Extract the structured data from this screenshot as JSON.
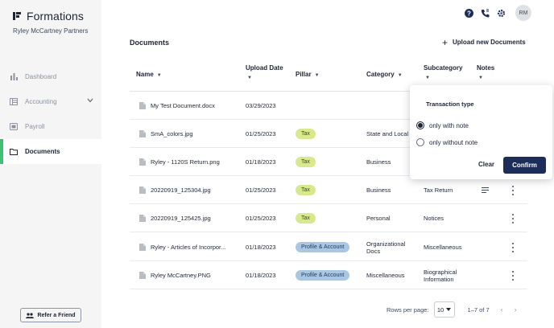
{
  "sidebar": {
    "brand": "Formations",
    "company": "Ryley McCartney Partners",
    "items": [
      {
        "label": "Dashboard",
        "icon": "bar-chart-icon"
      },
      {
        "label": "Accounting",
        "icon": "ledger-icon"
      },
      {
        "label": "Payroll",
        "icon": "payroll-icon"
      },
      {
        "label": "Documents",
        "icon": "folder-icon"
      }
    ],
    "active_item": "Documents",
    "refer_label": "Refer a Friend"
  },
  "topbar": {
    "icons": [
      "help-icon",
      "phone-icon",
      "gear-icon"
    ],
    "avatar_initials": "RM"
  },
  "main": {
    "title": "Documents",
    "upload_label": "Upload new Documents",
    "columns": {
      "name": "Name",
      "upload_date_line1": "Upload Date",
      "pillar": "Pillar",
      "category": "Category",
      "subcategory": "Subcategory",
      "notes": "Notes"
    },
    "rows": [
      {
        "name": "My Test Document.docx",
        "date": "03/29/2023",
        "pillar": "",
        "category": "",
        "subcategory": "",
        "has_notes": false
      },
      {
        "name": "SmA_colors.jpg",
        "date": "01/25/2023",
        "pillar": "Tax",
        "category": "State and Local",
        "subcategory": "",
        "has_notes": false
      },
      {
        "name": "Ryley - 1120S Return.png",
        "date": "01/18/2023",
        "pillar": "Tax",
        "category": "Business",
        "subcategory": "",
        "has_notes": false
      },
      {
        "name": "20220919_125304.jpg",
        "date": "01/25/2023",
        "pillar": "Tax",
        "category": "Business",
        "subcategory": "Tax Return",
        "has_notes": true
      },
      {
        "name": "20220919_125425.jpg",
        "date": "01/25/2023",
        "pillar": "Tax",
        "category": "Personal",
        "subcategory": "Notices",
        "has_notes": false
      },
      {
        "name": "Ryley - Articles of Incorpor...",
        "date": "01/18/2023",
        "pillar": "Profile & Account",
        "category": "Organizational Docs",
        "subcategory": "Miscellaneous",
        "has_notes": false
      },
      {
        "name": "Ryley McCartney.PNG",
        "date": "01/18/2023",
        "pillar": "Profile & Account",
        "category": "Miscellaneous",
        "subcategory": "Biographical Information",
        "has_notes": false
      }
    ]
  },
  "pagination": {
    "rows_per_page_label": "Rows per page:",
    "rows_per_page_value": "10",
    "range": "1–7 of 7"
  },
  "filter_popover": {
    "title": "Transaction type",
    "options": [
      "only with note",
      "only without note"
    ],
    "selected": "only with note",
    "clear_label": "Clear",
    "confirm_label": "Confirm"
  },
  "colors": {
    "accent_active": "#3fbf73",
    "tax_pill": "#d7e98a",
    "profile_pill": "#a9c7e2",
    "confirm_button": "#1d2d5a"
  }
}
